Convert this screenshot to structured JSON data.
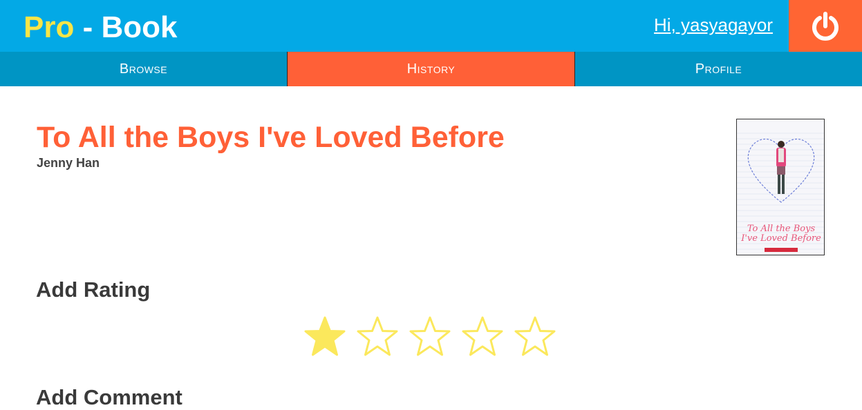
{
  "header": {
    "logo_pro": "Pro",
    "logo_rest": " - Book",
    "greeting": "Hi, yasyagayor",
    "logout_icon": "power-icon"
  },
  "nav": {
    "items": [
      {
        "label": "Browse",
        "active": false
      },
      {
        "label": "History",
        "active": true
      },
      {
        "label": "Profile",
        "active": false
      }
    ]
  },
  "book": {
    "title": "To All the Boys I've Loved Before",
    "author": "Jenny Han",
    "cover_icon": "book-cover-image"
  },
  "rating": {
    "heading": "Add Rating",
    "value": 1,
    "max": 5
  },
  "comment": {
    "heading": "Add Comment"
  },
  "colors": {
    "header_bg": "#03a9e6",
    "nav_bg": "#0095c4",
    "accent": "#ff6037",
    "logo_yellow": "#f9e547",
    "star_yellow": "#fbe85c"
  }
}
